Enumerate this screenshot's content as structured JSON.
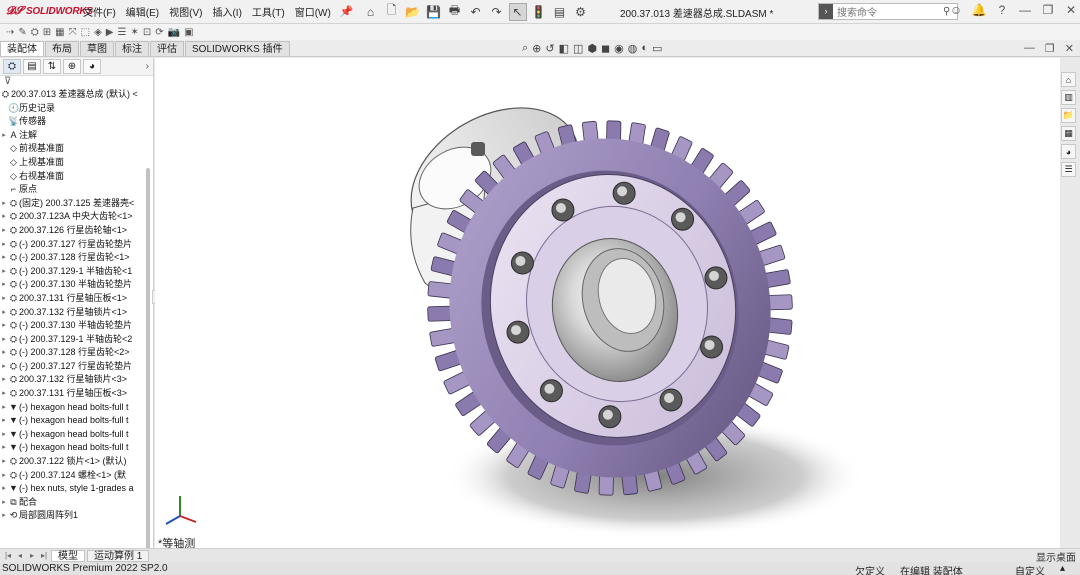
{
  "app": {
    "brand": "SOLIDWORKS",
    "doc_title": "200.37.013 差速器总成.SLDASM *"
  },
  "menu": [
    "文件(F)",
    "编辑(E)",
    "视图(V)",
    "插入(I)",
    "工具(T)",
    "窗口(W)"
  ],
  "search": {
    "placeholder": "搜索命令"
  },
  "command_tabs": [
    "装配体",
    "布局",
    "草图",
    "标注",
    "评估",
    "SOLIDWORKS 插件"
  ],
  "feature_tree": {
    "root": "200.37.013 差速器总成 (默认) <",
    "items": [
      {
        "icon": "history-icon",
        "label": "历史记录",
        "arrow": false
      },
      {
        "icon": "sensor-icon",
        "label": "传感器",
        "arrow": false
      },
      {
        "icon": "annotation-icon",
        "label": "注解",
        "arrow": true
      },
      {
        "icon": "plane-icon",
        "label": "前视基准面",
        "arrow": false
      },
      {
        "icon": "plane-icon",
        "label": "上视基准面",
        "arrow": false
      },
      {
        "icon": "plane-icon",
        "label": "右视基准面",
        "arrow": false
      },
      {
        "icon": "origin-icon",
        "label": "原点",
        "arrow": false
      },
      {
        "icon": "part-icon",
        "label": "(固定) 200.37.125  差速器壳<",
        "arrow": true
      },
      {
        "icon": "part-icon",
        "label": "200.37.123A  中央大齿轮<1>",
        "arrow": true
      },
      {
        "icon": "part-icon",
        "label": "200.37.126  行星齿轮轴<1>",
        "arrow": true
      },
      {
        "icon": "part-icon",
        "label": "(-) 200.37.127  行星齿轮垫片",
        "arrow": true
      },
      {
        "icon": "part-icon",
        "label": "(-) 200.37.128  行星齿轮<1>",
        "arrow": true
      },
      {
        "icon": "part-icon",
        "label": "(-) 200.37.129-1 半轴齿轮<1",
        "arrow": true
      },
      {
        "icon": "part-icon",
        "label": "(-) 200.37.130  半轴齿轮垫片",
        "arrow": true
      },
      {
        "icon": "part-icon",
        "label": "200.37.131  行星轴压板<1>",
        "arrow": true
      },
      {
        "icon": "part-icon",
        "label": "200.37.132  行星轴锁片<1>",
        "arrow": true
      },
      {
        "icon": "part-icon",
        "label": "(-) 200.37.130  半轴齿轮垫片",
        "arrow": true
      },
      {
        "icon": "part-icon",
        "label": "(-) 200.37.129-1 半轴齿轮<2",
        "arrow": true
      },
      {
        "icon": "part-icon",
        "label": "(-) 200.37.128  行星齿轮<2>",
        "arrow": true
      },
      {
        "icon": "part-icon",
        "label": "(-) 200.37.127  行星齿轮垫片",
        "arrow": true
      },
      {
        "icon": "part-icon",
        "label": "200.37.132  行星轴锁片<3>",
        "arrow": true
      },
      {
        "icon": "part-icon",
        "label": "200.37.131  行星轴压板<3>",
        "arrow": true
      },
      {
        "icon": "bolt-icon",
        "label": "(-) hexagon head bolts-full t",
        "arrow": true
      },
      {
        "icon": "bolt-icon",
        "label": "(-) hexagon head bolts-full t",
        "arrow": true
      },
      {
        "icon": "bolt-icon",
        "label": "(-) hexagon head bolts-full t",
        "arrow": true
      },
      {
        "icon": "bolt-icon",
        "label": "(-) hexagon head bolts-full t",
        "arrow": true
      },
      {
        "icon": "part-icon",
        "label": "200.37.122  锁片<1> (默认)",
        "arrow": true
      },
      {
        "icon": "part-icon",
        "label": "(-) 200.37.124  螺栓<1> (默",
        "arrow": true
      },
      {
        "icon": "bolt-icon",
        "label": "(-) hex nuts, style 1-grades a",
        "arrow": true
      },
      {
        "icon": "mate-icon",
        "label": "配合",
        "arrow": true
      },
      {
        "icon": "pattern-icon",
        "label": "局部圆周阵列1",
        "arrow": true
      }
    ]
  },
  "viewport": {
    "view_label": "*等轴测"
  },
  "bottom_tabs": [
    "模型",
    "运动算例 1"
  ],
  "status_bar": {
    "product": "SOLIDWORKS Premium 2022 SP2.0",
    "constraint": "欠定义",
    "state": "在编辑 装配体",
    "units": "自定义",
    "desktop": "显示桌面"
  }
}
